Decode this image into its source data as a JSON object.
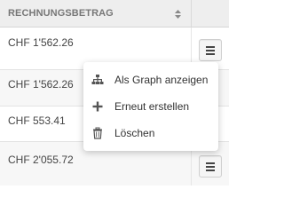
{
  "table": {
    "column_header": "RECHNUNGSBETRAG",
    "sort_icon": "sort-icon",
    "rows": [
      {
        "amount": "CHF 1'562.26"
      },
      {
        "amount": "CHF 1'562.26"
      },
      {
        "amount": "CHF 553.41"
      },
      {
        "amount": "CHF 2'055.72"
      }
    ],
    "row_action_icon": "hamburger-menu-icon"
  },
  "context_menu": {
    "items": [
      {
        "label": "Als Graph anzeigen",
        "icon": "sitemap-icon"
      },
      {
        "label": "Erneut erstellen",
        "icon": "plus-icon"
      },
      {
        "label": "Löschen",
        "icon": "trash-icon"
      }
    ]
  },
  "colors": {
    "header_bg": "#eeeeee",
    "header_text": "#777777",
    "row_alt_bg": "#f7f7f7",
    "menu_bg": "#ffffff"
  }
}
